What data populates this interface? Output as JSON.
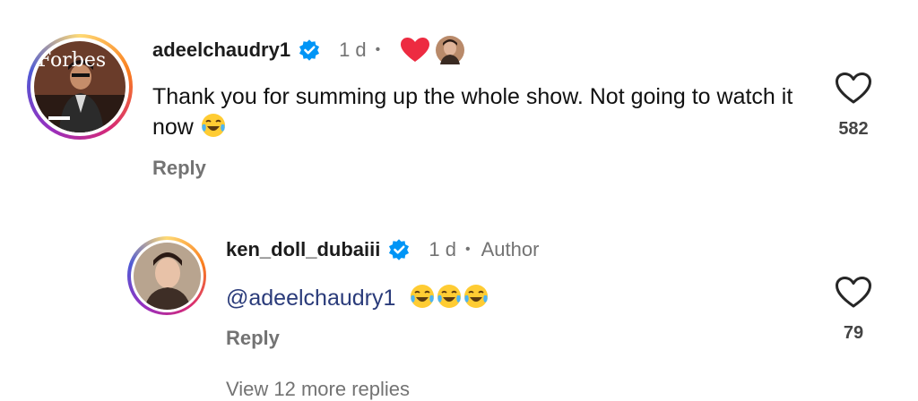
{
  "comment": {
    "username": "adeelchaudry1",
    "time": "1 d",
    "dot": "•",
    "text": "Thank you for summing up the whole show. Not going to watch it now",
    "reply_label": "Reply",
    "like_count": "582",
    "avatar_magazine_text": "Forbes",
    "heart_color": "#ed2b41"
  },
  "reply": {
    "username": "ken_doll_dubaiii",
    "time": "1 d",
    "dot": "•",
    "author_label": "Author",
    "mention": "@adeelchaudry1",
    "reply_label": "Reply",
    "like_count": "79"
  },
  "footer": {
    "view_more": "View 12 more replies"
  },
  "icons": {
    "verified": "verified-badge-icon",
    "like": "heart-outline-icon",
    "emoji": "face-with-tears-of-joy-icon",
    "liked_by_author": "red-heart-icon"
  },
  "colors": {
    "verified_blue": "#0095f6",
    "muted_text": "#737373",
    "mention": "#2a3b7a"
  }
}
